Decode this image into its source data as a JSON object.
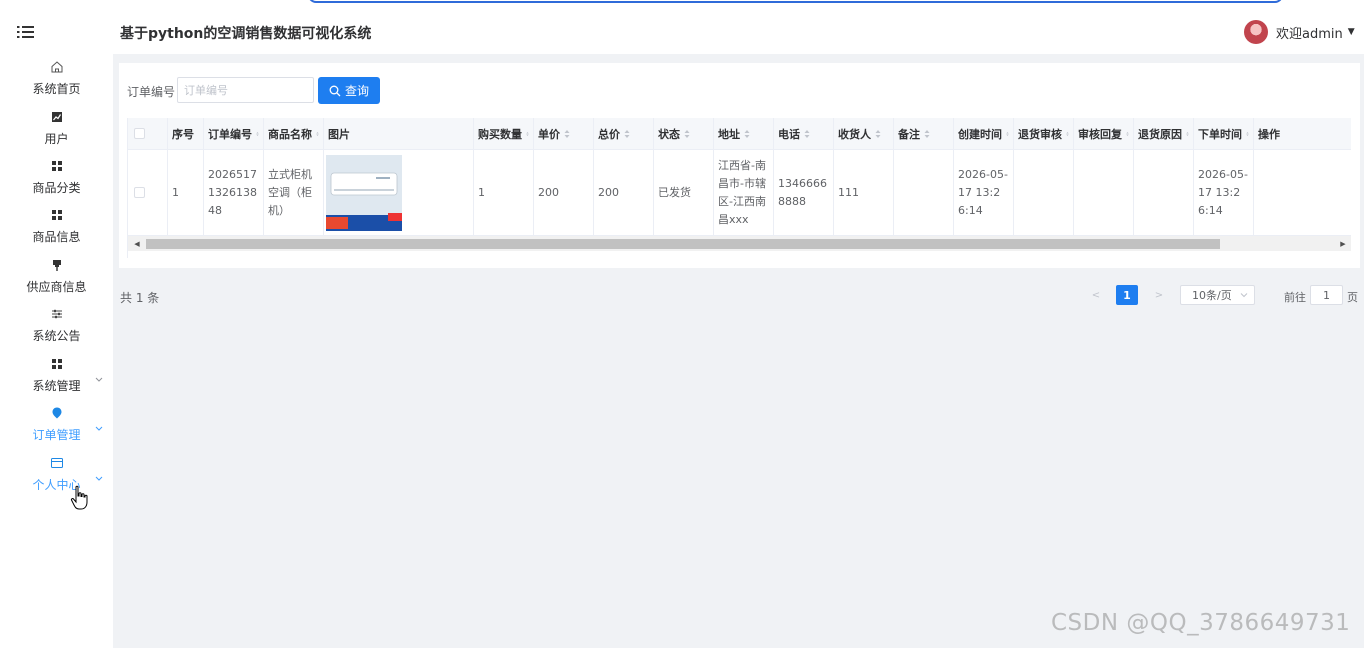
{
  "header": {
    "title": "基于python的空调销售数据可视化系统",
    "user_label": "欢迎admin"
  },
  "sidebar": {
    "items": [
      {
        "label": "系统首页",
        "icon": "home-icon"
      },
      {
        "label": "用户",
        "icon": "chart-icon"
      },
      {
        "label": "商品分类",
        "icon": "grid-icon"
      },
      {
        "label": "商品信息",
        "icon": "grid-icon"
      },
      {
        "label": "供应商信息",
        "icon": "pin-icon"
      },
      {
        "label": "系统公告",
        "icon": "sliders-icon"
      },
      {
        "label": "系统管理",
        "icon": "grid-icon"
      },
      {
        "label": "订单管理",
        "icon": "location-icon"
      },
      {
        "label": "个人中心",
        "icon": "card-icon"
      }
    ]
  },
  "search": {
    "label": "订单编号",
    "placeholder": "订单编号",
    "value": "",
    "button_label": "查询"
  },
  "table": {
    "columns": [
      "序号",
      "订单编号",
      "商品名称",
      "图片",
      "购买数量",
      "单价",
      "总价",
      "状态",
      "地址",
      "电话",
      "收货人",
      "备注",
      "创建时间",
      "退货审核",
      "审核回复",
      "退货原因",
      "下单时间",
      "操作"
    ],
    "rows": [
      {
        "index": "1",
        "order_no": "2026517132613848",
        "product": "立式柜机空调（柜机）",
        "image": "air-conditioner-photo",
        "quantity": "1",
        "unit_price": "200",
        "total": "200",
        "status": "已发货",
        "address": "江西省-南昌市-市辖区-江西南昌xxx",
        "phone": "13466668888",
        "receiver": "111",
        "remark": "",
        "created": "2026-05-17 13:26:14",
        "return_review": "",
        "review_reply": "",
        "return_reason": "",
        "order_time": "2026-05-17 13:26:14",
        "actions": ""
      }
    ]
  },
  "pagination": {
    "total_label": "共 1 条",
    "current_page": "1",
    "prev": "<",
    "next": ">",
    "page_size": "10条/页",
    "goto_prefix": "前往",
    "goto_value": "1",
    "goto_suffix": "页"
  },
  "watermark": "CSDN @QQ_3786649731",
  "colors": {
    "primary": "#1e7ef0",
    "active_menu": "#409eff",
    "background": "#f0f2f5"
  }
}
